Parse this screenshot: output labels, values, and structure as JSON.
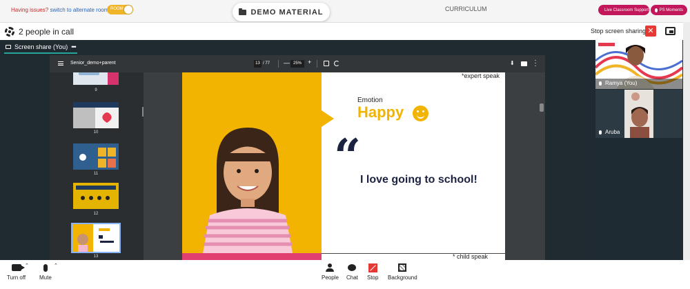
{
  "topbar": {
    "issues_label": "Having issues?",
    "alt_room_link": "switch to alternate room",
    "room_toggle_label": "ROOM",
    "demo_material_label": "DEMO MATERIAL",
    "curriculum_label": "CURRICULUM",
    "live_support_label": "Live Classroom Support",
    "ps_moments_label": "PS Moments",
    "accent_color": "#c2185b"
  },
  "call_header": {
    "people_count": "2 people in call",
    "stop_screen_sharing": "Stop screen sharing",
    "close_glyph": "✕"
  },
  "share_tab": {
    "label": "Screen share (You)",
    "more": "•••"
  },
  "pdf": {
    "doc_name": "Senior_demo+parent",
    "page_current": "13",
    "page_total": "/ 77",
    "zoom": "25%",
    "zoom_minus": "—",
    "zoom_plus": "+",
    "thumbnails": [
      {
        "num": "9"
      },
      {
        "num": "10"
      },
      {
        "num": "11"
      },
      {
        "num": "12"
      },
      {
        "num": "13"
      }
    ]
  },
  "slide": {
    "expert_note": "*expert speak",
    "emotion_label": "Emotion",
    "emotion_value": "Happy",
    "quote": "I love going to school!",
    "child_note": "* child speak"
  },
  "participants": [
    {
      "name": "Ramya (You)"
    },
    {
      "name": "Aruba"
    }
  ],
  "bottom_bar": {
    "turn_off": "Turn off",
    "mute": "Mute",
    "people": "People",
    "chat": "Chat",
    "stop": "Stop",
    "background": "Background"
  }
}
